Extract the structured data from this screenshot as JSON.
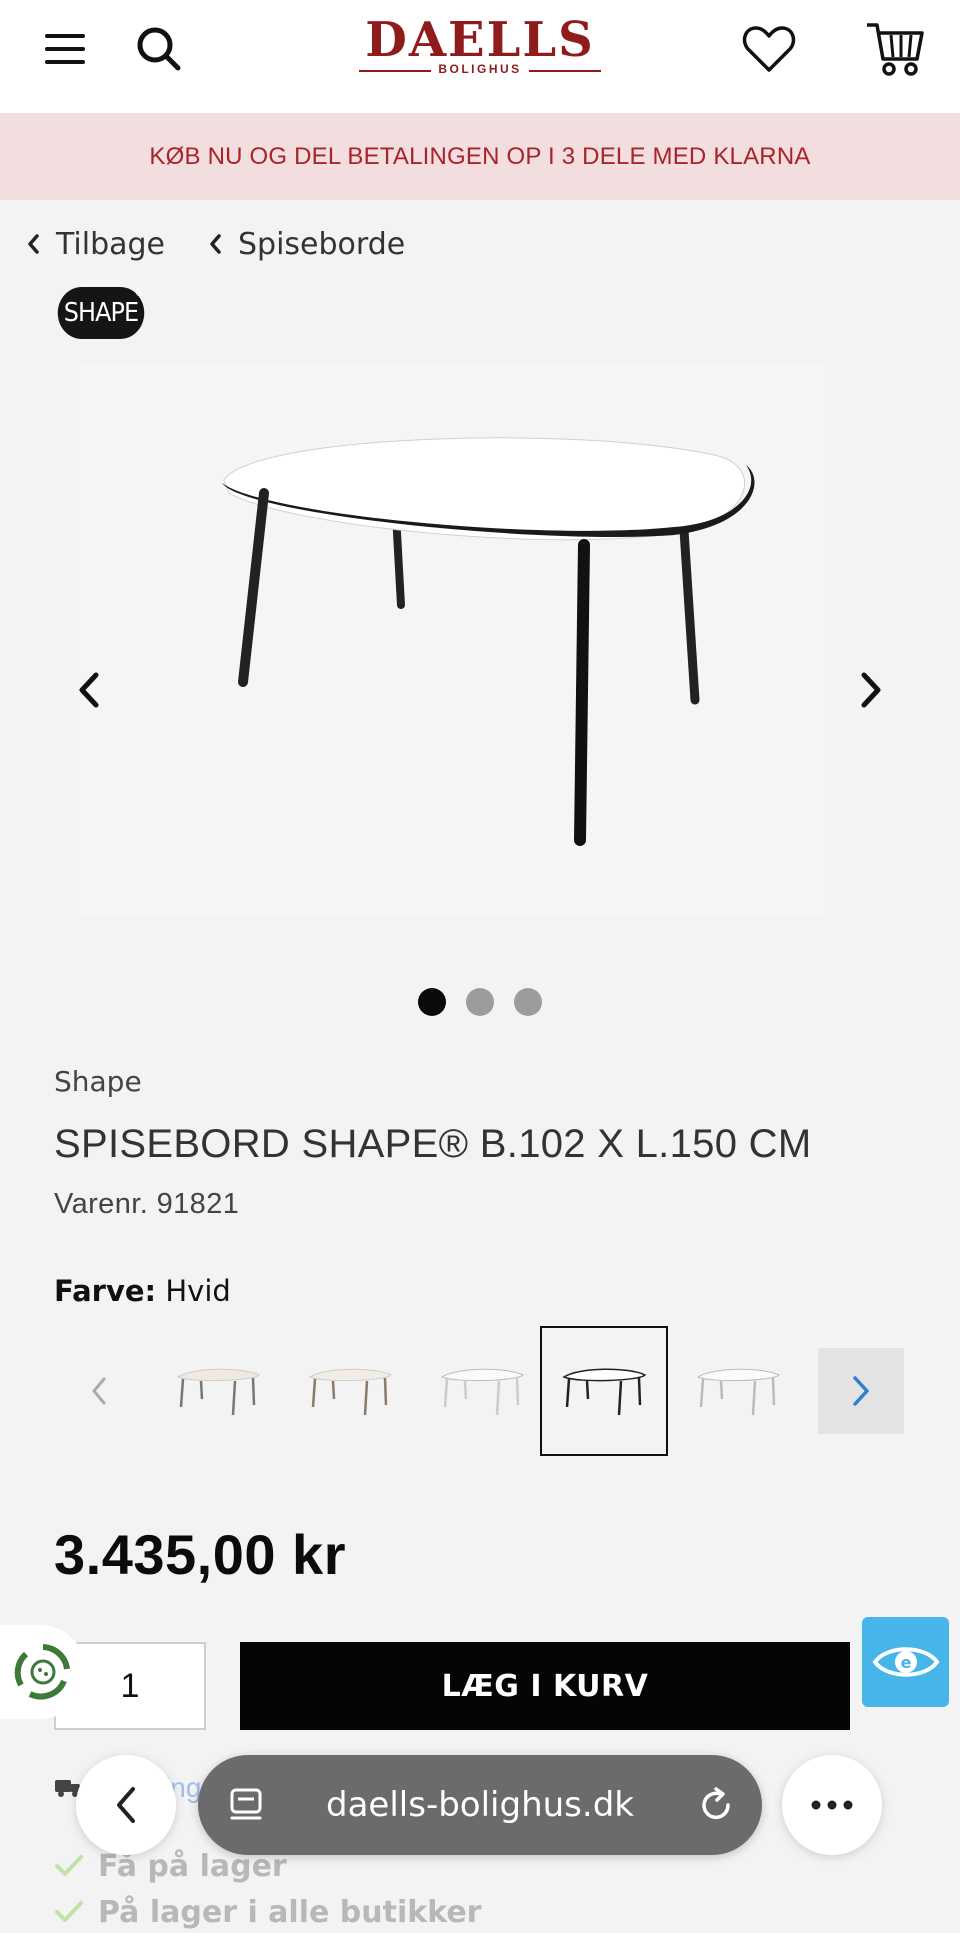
{
  "header": {
    "logo_main": "DAELLS",
    "logo_sub": "BOLIGHUS",
    "icons": [
      "menu-icon",
      "search-icon",
      "heart-icon",
      "cart-icon"
    ]
  },
  "banner": {
    "text": "KØB NU OG DEL BETALINGEN OP I 3 DELE MED KLARNA"
  },
  "breadcrumb": {
    "back": "Tilbage",
    "category": "Spiseborde"
  },
  "brand_logo": {
    "text": "SHAPE",
    "reg": "®"
  },
  "gallery": {
    "slides": 3,
    "active_index": 0
  },
  "product": {
    "brand": "Shape",
    "title": "SPISEBORD SHAPE® B.102 X L.150 CM",
    "sku": "Varenr. 91821",
    "color_label": "Farve:",
    "color_value": "Hvid",
    "swatches": [
      "variant-1",
      "variant-2",
      "variant-3",
      "variant-4",
      "variant-5"
    ],
    "selected_swatch": 3,
    "price": "3.435,00 kr",
    "quantity": "1",
    "add_to_cart": "LÆG I KURV"
  },
  "stock": {
    "shipping_link": "Levering",
    "lines": [
      "Få på lager",
      "På lager i alle butikker"
    ]
  },
  "browser": {
    "url": "daells-bolighus.dk"
  },
  "colors": {
    "brand": "#8f1b1b",
    "banner_bg": "#f2dede",
    "banner_text": "#a9232a",
    "cta": "#050505",
    "accessibility": "#45b5ea"
  }
}
